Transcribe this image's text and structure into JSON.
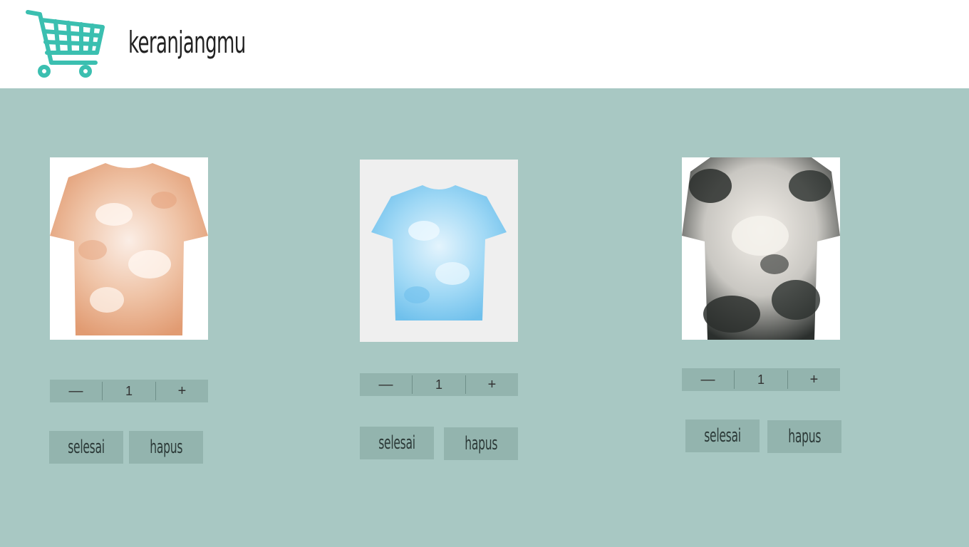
{
  "header": {
    "brand": "keranjangmu",
    "cart_icon": "shopping-cart-icon",
    "accent_color": "#3bbfb0"
  },
  "products": [
    {
      "name": "tie-dye-tshirt-orange",
      "color": "#e6a47e",
      "quantity": "1",
      "done_label": "selesai",
      "delete_label": "hapus"
    },
    {
      "name": "tie-dye-tshirt-blue",
      "color": "#7ac8ee",
      "quantity": "1",
      "done_label": "selesai",
      "delete_label": "hapus"
    },
    {
      "name": "tie-dye-tshirt-black",
      "color": "#2b2f2d",
      "quantity": "1",
      "done_label": "selesai",
      "delete_label": "hapus"
    }
  ],
  "icons": {
    "decrement": "minus-icon",
    "increment": "plus-icon"
  },
  "colors": {
    "background": "#a8c8c3",
    "control": "#93b4ae"
  }
}
